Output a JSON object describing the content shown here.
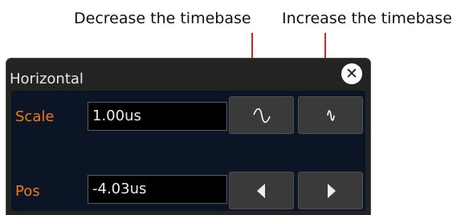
{
  "callouts": {
    "decrease": "Decrease the timebase",
    "increase": "Increase the timebase",
    "arrow_color": "#e41e20"
  },
  "dialog": {
    "title": "Horizontal",
    "close_icon": "close-icon",
    "rows": [
      {
        "label": "Scale",
        "value": "1.00us",
        "buttons": [
          {
            "icon": "wide-sine-wave-icon",
            "action": "decrease timebase"
          },
          {
            "icon": "narrow-sine-wave-icon",
            "action": "increase timebase"
          }
        ]
      },
      {
        "label": "Pos",
        "value": "-4.03us",
        "buttons": [
          {
            "icon": "triangle-left-icon"
          },
          {
            "icon": "triangle-right-icon"
          }
        ]
      }
    ]
  },
  "colors": {
    "label": "#f07a16",
    "panel": "#232323",
    "panel_body": "#0c1525",
    "field_bg": "#000000",
    "button_bg": "#3a3a3a"
  }
}
